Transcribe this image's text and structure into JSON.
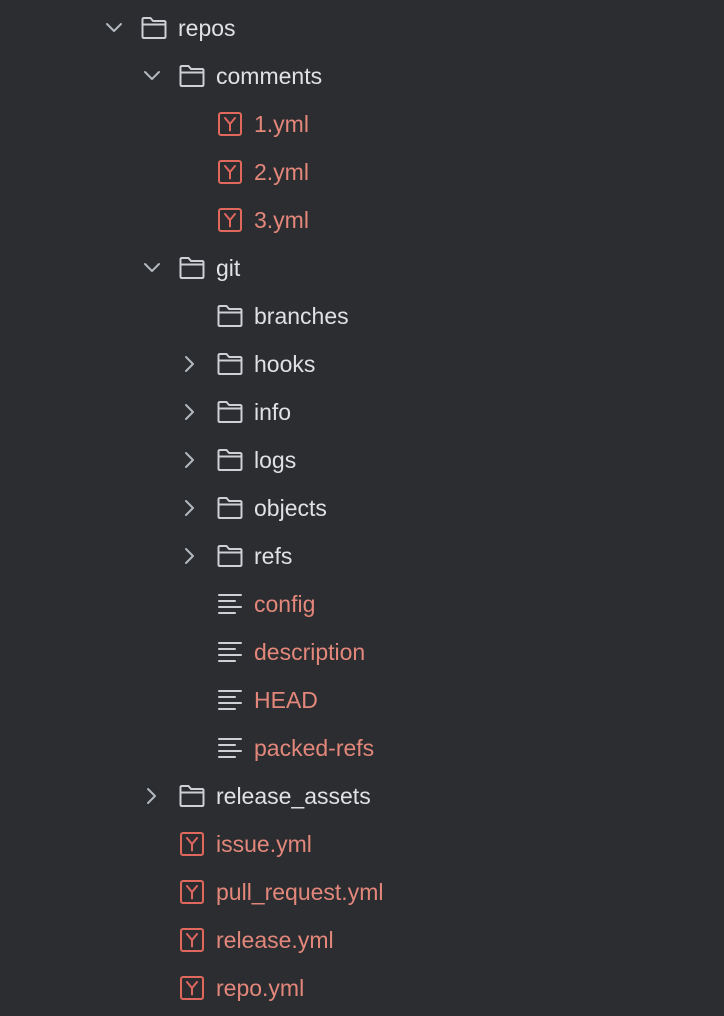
{
  "colors": {
    "background": "#2b2d30",
    "folder_text": "#dfe1e5",
    "file_text": "#e3877b",
    "folder_icon": "#ced0d6",
    "yaml_icon": "#e0685c",
    "chevron": "#b4b8bf",
    "text_file_icon": "#ced0d6"
  },
  "tree": {
    "rows": [
      {
        "label": "repos",
        "kind": "folder",
        "depth": 0,
        "chevron": "down"
      },
      {
        "label": "comments",
        "kind": "folder",
        "depth": 1,
        "chevron": "down"
      },
      {
        "label": "1.yml",
        "kind": "yaml",
        "depth": 2,
        "chevron": "none"
      },
      {
        "label": "2.yml",
        "kind": "yaml",
        "depth": 2,
        "chevron": "none"
      },
      {
        "label": "3.yml",
        "kind": "yaml",
        "depth": 2,
        "chevron": "none"
      },
      {
        "label": "git",
        "kind": "folder",
        "depth": 1,
        "chevron": "down"
      },
      {
        "label": "branches",
        "kind": "folder",
        "depth": 2,
        "chevron": "none"
      },
      {
        "label": "hooks",
        "kind": "folder",
        "depth": 2,
        "chevron": "right"
      },
      {
        "label": "info",
        "kind": "folder",
        "depth": 2,
        "chevron": "right"
      },
      {
        "label": "logs",
        "kind": "folder",
        "depth": 2,
        "chevron": "right"
      },
      {
        "label": "objects",
        "kind": "folder",
        "depth": 2,
        "chevron": "right"
      },
      {
        "label": "refs",
        "kind": "folder",
        "depth": 2,
        "chevron": "right"
      },
      {
        "label": "config",
        "kind": "text",
        "depth": 2,
        "chevron": "none"
      },
      {
        "label": "description",
        "kind": "text",
        "depth": 2,
        "chevron": "none"
      },
      {
        "label": "HEAD",
        "kind": "text",
        "depth": 2,
        "chevron": "none"
      },
      {
        "label": "packed-refs",
        "kind": "text",
        "depth": 2,
        "chevron": "none"
      },
      {
        "label": "release_assets",
        "kind": "folder",
        "depth": 1,
        "chevron": "right"
      },
      {
        "label": "issue.yml",
        "kind": "yaml",
        "depth": 1,
        "chevron": "none"
      },
      {
        "label": "pull_request.yml",
        "kind": "yaml",
        "depth": 1,
        "chevron": "none"
      },
      {
        "label": "release.yml",
        "kind": "yaml",
        "depth": 1,
        "chevron": "none"
      },
      {
        "label": "repo.yml",
        "kind": "yaml",
        "depth": 1,
        "chevron": "none"
      }
    ]
  }
}
